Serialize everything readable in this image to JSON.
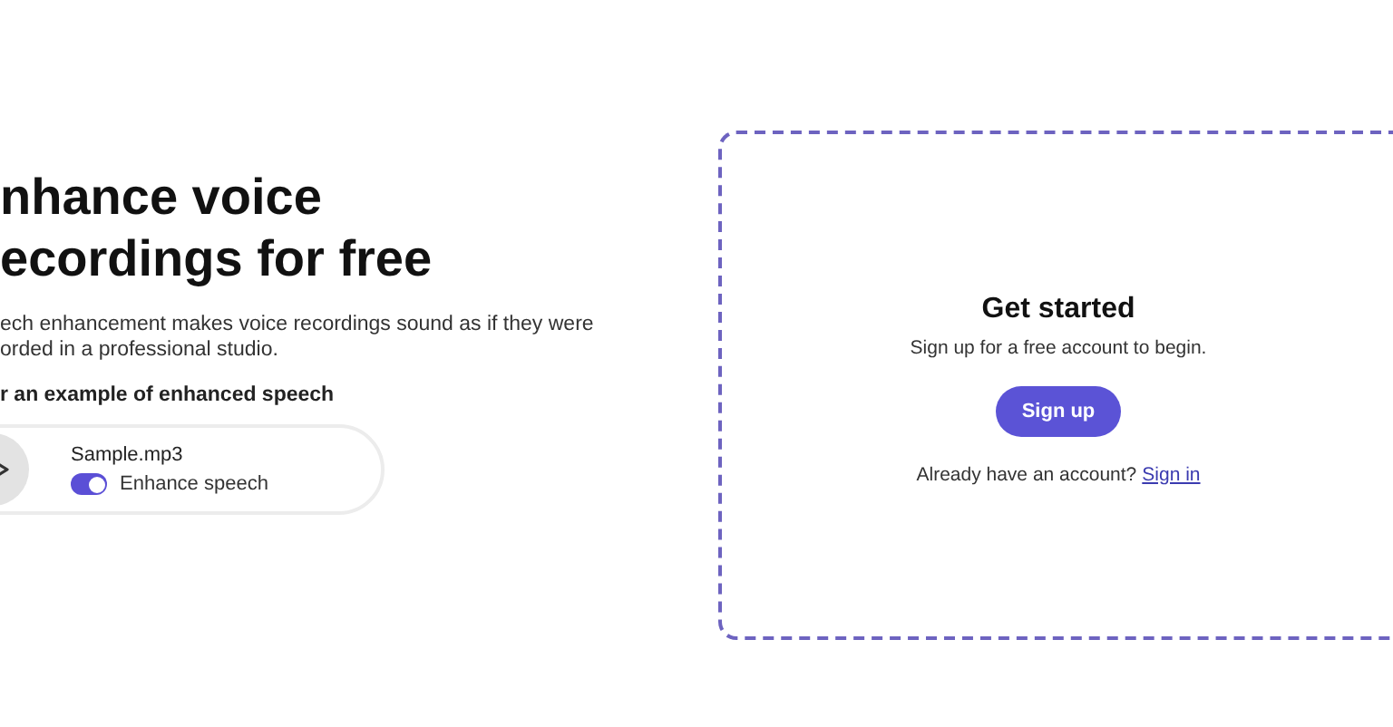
{
  "hero": {
    "title_lines": [
      "nhance voice",
      "ecordings for free"
    ],
    "description": "ech enhancement makes voice recordings sound as if they were\norded in a professional studio.",
    "example_label": "r an example of enhanced speech"
  },
  "player": {
    "file_name": "Sample.mp3",
    "toggle_label": "Enhance speech",
    "enhance_on": true
  },
  "signup_card": {
    "title": "Get started",
    "subtitle": "Sign up for a free account to begin.",
    "button": "Sign up",
    "signin_prompt": "Already have an account?",
    "signin_link": "Sign in"
  }
}
